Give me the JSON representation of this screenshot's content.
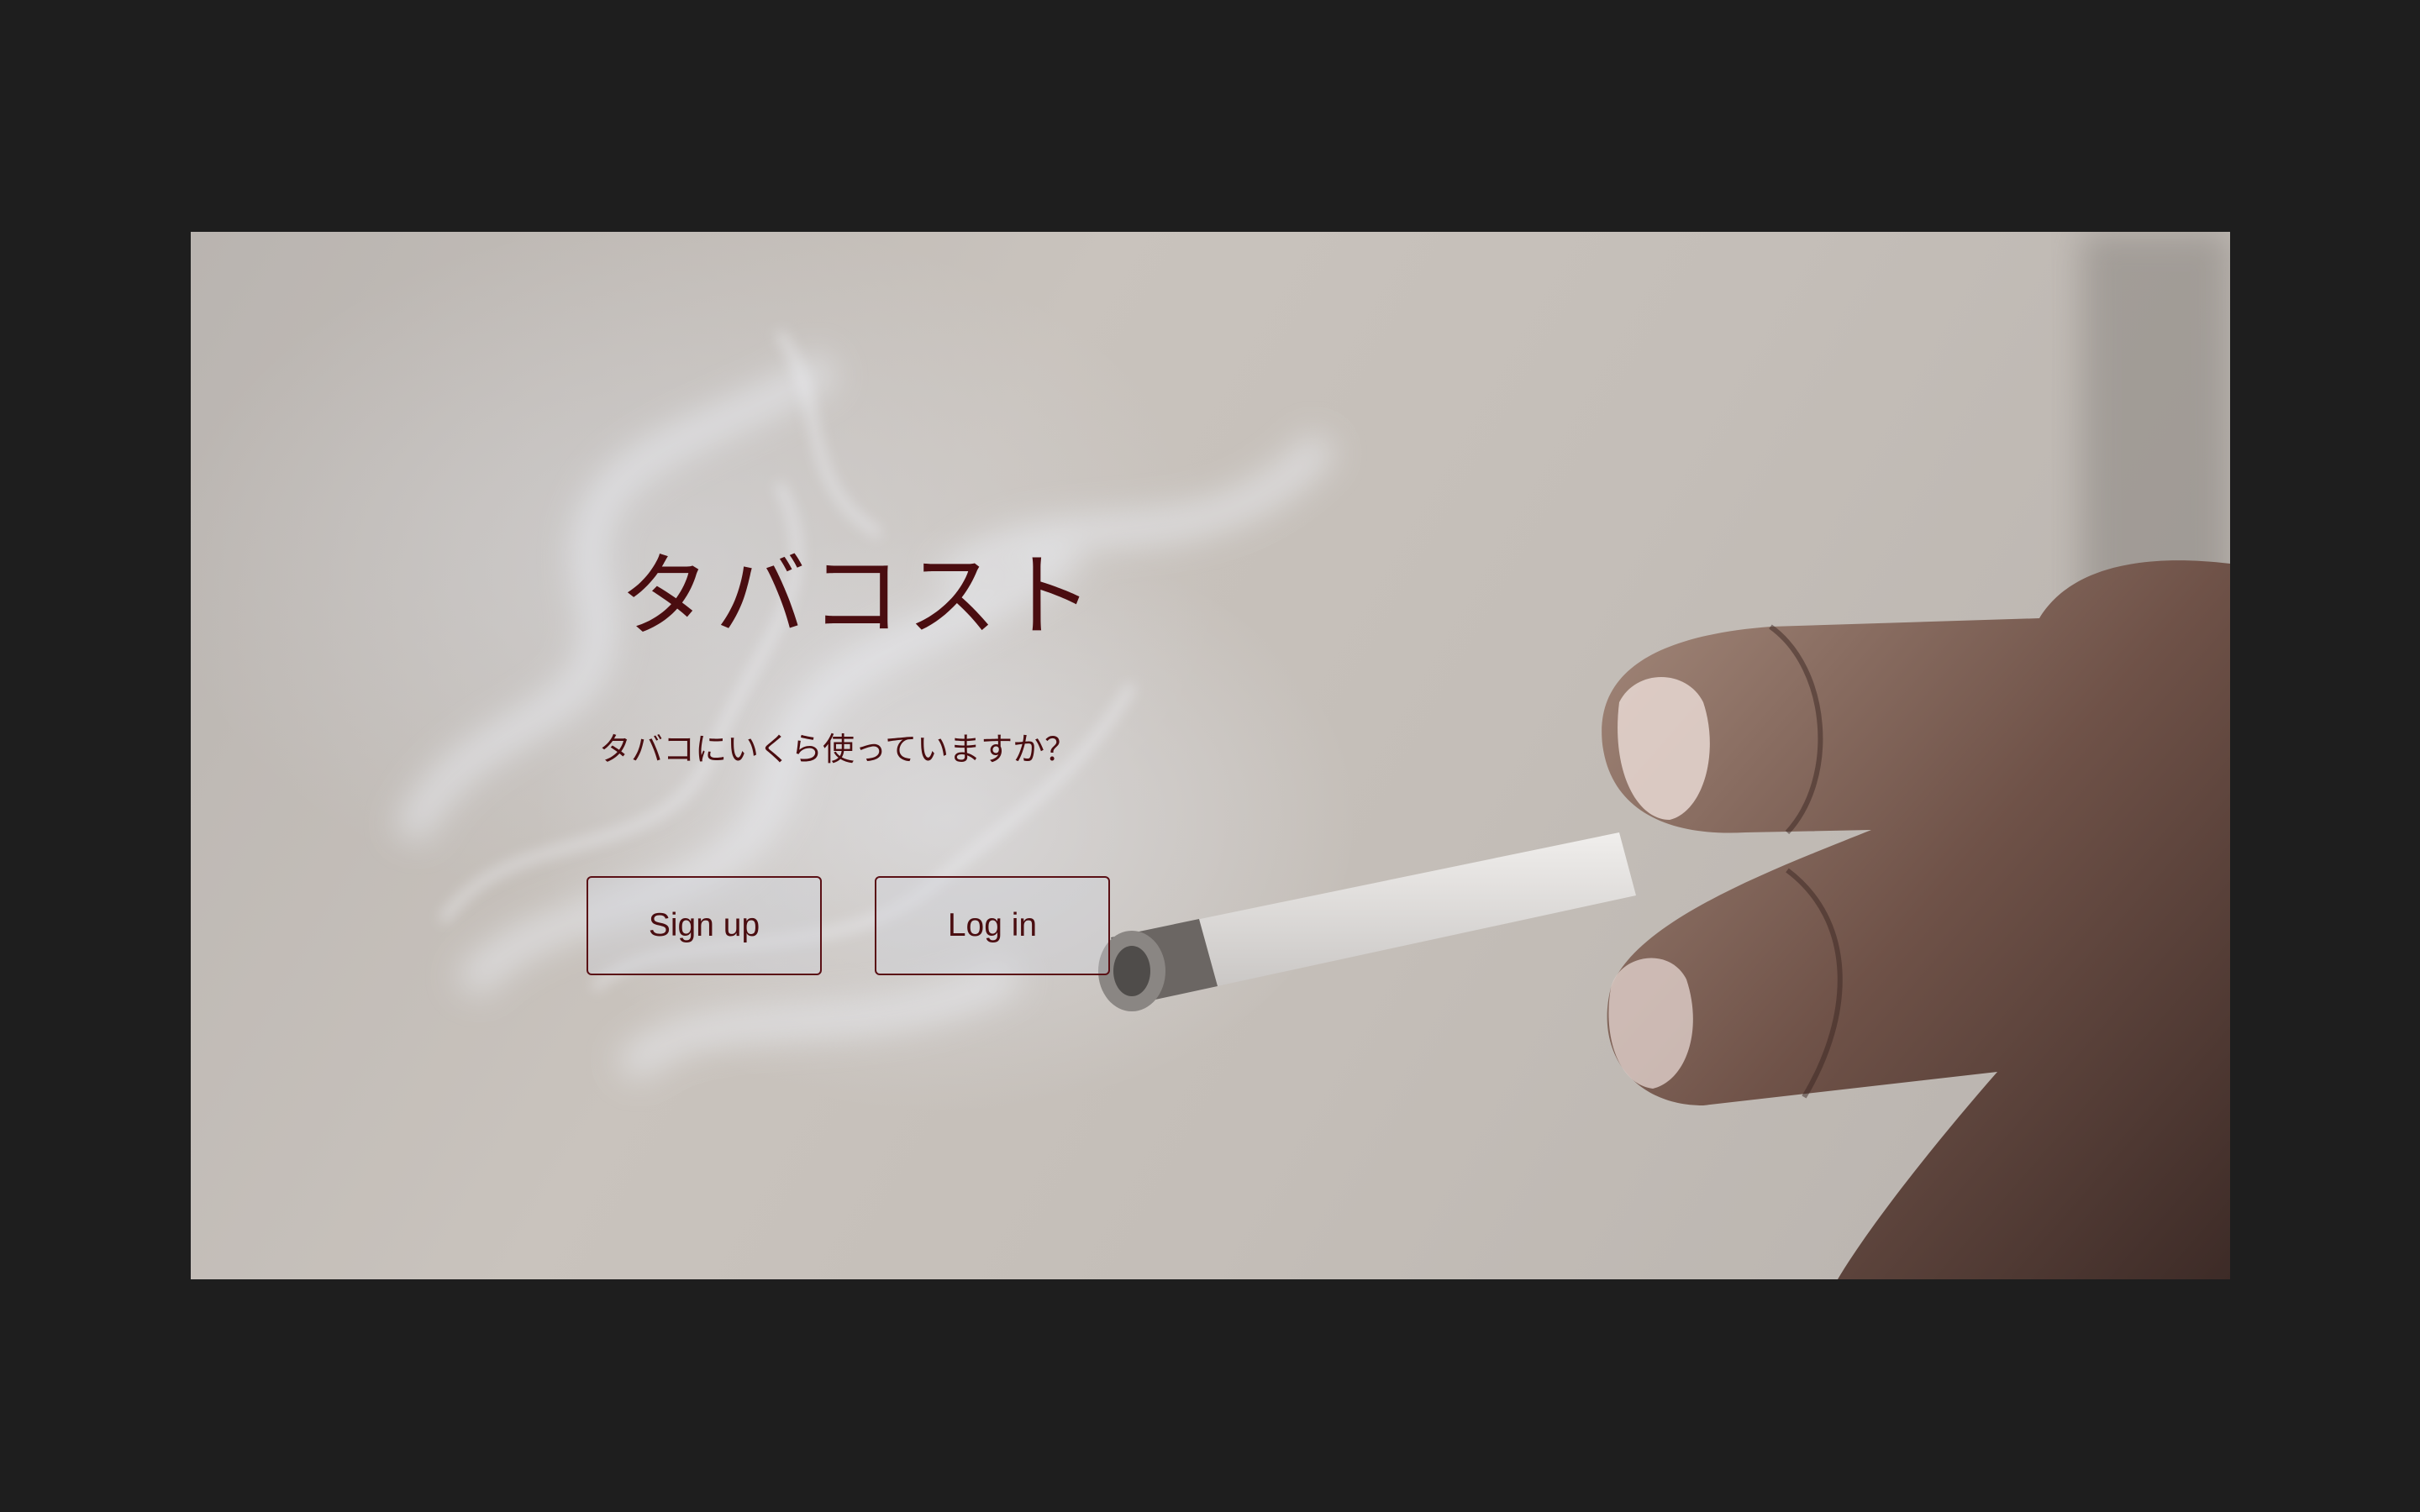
{
  "hero": {
    "title": "タバコスト",
    "subtitle": "タバコにいくら使っていますか？",
    "background_image": "hand-holding-lit-cigarette-with-smoke"
  },
  "buttons": {
    "signup_label": "Sign up",
    "login_label": "Log in"
  },
  "colors": {
    "page_background": "#1e1e1e",
    "accent_text": "#4a0d10",
    "button_border": "#5a1015"
  }
}
